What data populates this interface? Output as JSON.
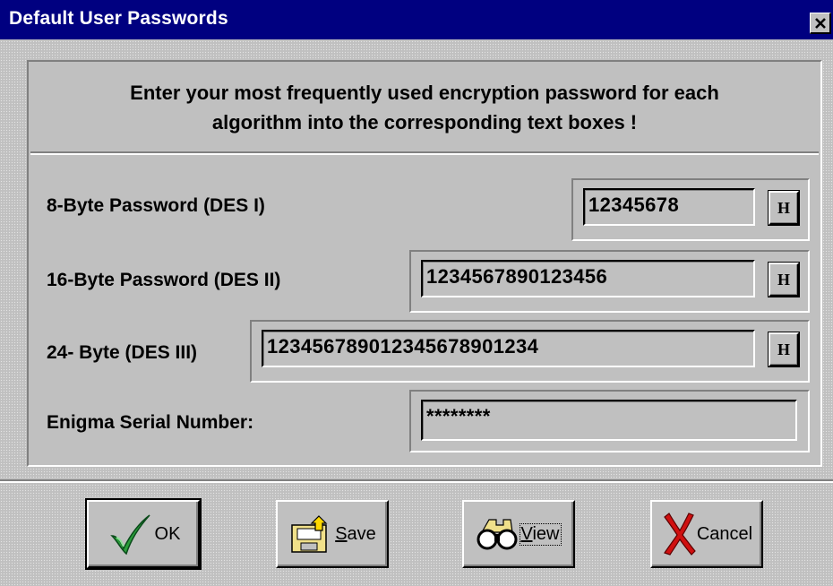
{
  "window": {
    "title": "Default User Passwords"
  },
  "header": {
    "instruction_line1": "Enter your most frequently used encryption password for each",
    "instruction_line2": "algorithm into the corresponding text boxes !"
  },
  "fields": [
    {
      "label": "8-Byte Password (DES I)",
      "value": "12345678",
      "button": "H"
    },
    {
      "label": "16-Byte Password (DES II)",
      "value": "1234567890123456",
      "button": "H"
    },
    {
      "label": "24- Byte (DES III)",
      "value": "123456789012345678901234",
      "button": "H"
    },
    {
      "label": "Enigma Serial Number:",
      "value": "********"
    }
  ],
  "buttons": {
    "ok": {
      "label": "OK",
      "icon": "checkmark-icon"
    },
    "save": {
      "label_underlined": "S",
      "label_rest": "ave",
      "icon": "save-disk-icon"
    },
    "view": {
      "label_underlined": "V",
      "label_rest": "iew",
      "icon": "binoculars-icon"
    },
    "cancel": {
      "label": "Cancel",
      "icon": "red-x-icon"
    }
  },
  "colors": {
    "titlebar": "#000080",
    "face": "#c0c0c0",
    "check": "#2a9d3a",
    "cancel_x": "#d01010"
  }
}
